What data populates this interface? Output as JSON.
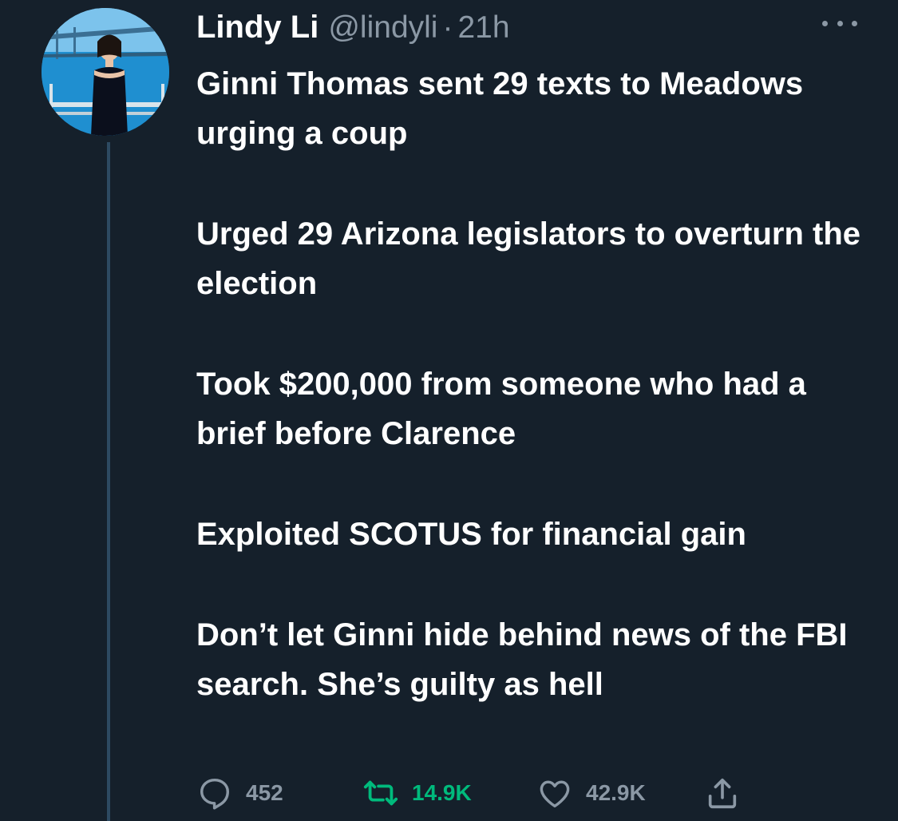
{
  "tweet": {
    "display_name": "Lindy Li",
    "handle": "@lindyli",
    "separator": "·",
    "time": "21h",
    "paragraphs": [
      "Ginni Thomas sent 29 texts to Meadows urging a coup",
      "Urged 29 Arizona legislators to overturn the election",
      "Took $200,000 from someone who had a brief before Clarence",
      "Exploited SCOTUS for financial gain",
      "Don’t let Ginni hide behind news of the FBI search. She’s guilty as hell"
    ],
    "actions": {
      "reply_icon": "comment-icon",
      "reply_count": "452",
      "retweet_icon": "retweet-icon",
      "retweet_count": "14.9K",
      "like_icon": "heart-icon",
      "like_count": "42.9K",
      "share_icon": "share-icon"
    }
  },
  "colors": {
    "background": "#15202b",
    "text_primary": "#ffffff",
    "text_secondary": "#8b98a5",
    "retweet_active": "#00ba7c"
  }
}
